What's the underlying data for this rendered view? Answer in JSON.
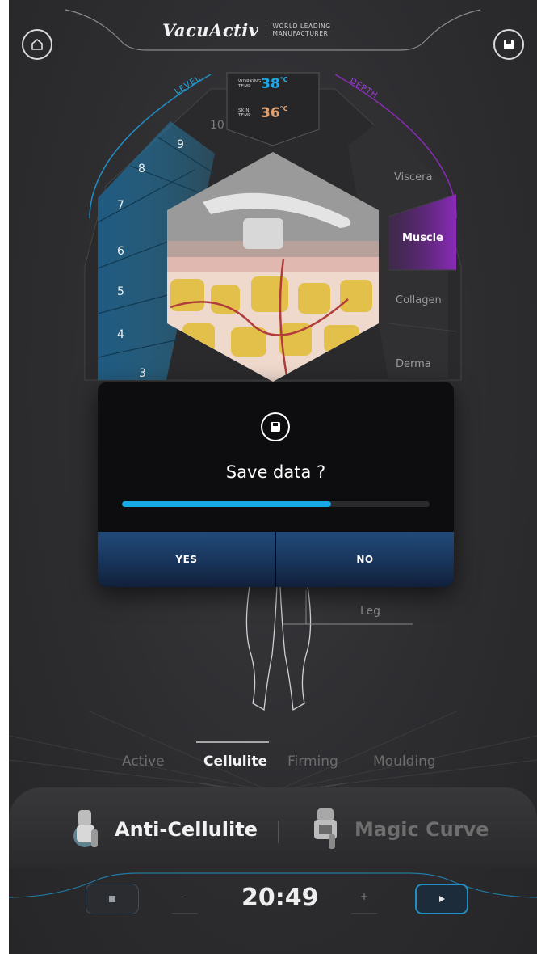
{
  "header": {
    "brand": "VacuActiv",
    "tagline_line1": "WORLD LEADING",
    "tagline_line2": "MANUFACTURER"
  },
  "icons": {
    "home": "home-icon",
    "save": "floppy-disk-icon"
  },
  "gauge": {
    "level_label": "LEVEL",
    "depth_label": "DEPTH",
    "working_temp_label_line1": "WORKING",
    "working_temp_label_line2": "TEMP",
    "working_temp_value": "38",
    "working_temp_unit": "°C",
    "skin_temp_label_line1": "SKIN",
    "skin_temp_label_line2": "TEMP",
    "skin_temp_value": "36",
    "skin_temp_unit": "°C",
    "levels": [
      "3",
      "4",
      "5",
      "6",
      "7",
      "8",
      "9",
      "10"
    ],
    "selected_level": 9,
    "depths": [
      "Viscera",
      "Muscle",
      "Collagen",
      "Derma"
    ],
    "selected_depth": "Muscle"
  },
  "colors": {
    "level_accent": "#1f8fc4",
    "depth_accent": "#8a2bb8",
    "working_temp": "#1fa8e6",
    "skin_temp": "#e0a070",
    "progress": "#17a9e3"
  },
  "dialog": {
    "title": "Save data ?",
    "progress_fraction": 0.68,
    "yes_label": "YES",
    "no_label": "NO"
  },
  "body_area": {
    "label": "Leg"
  },
  "modes": {
    "tabs": [
      "Active",
      "Cellulite",
      "Firming",
      "Moulding"
    ],
    "selected": "Cellulite"
  },
  "programs": {
    "items": [
      "Anti-Cellulite",
      "Magic Curve"
    ],
    "selected": "Anti-Cellulite"
  },
  "controls": {
    "minus_label": "-",
    "plus_label": "+",
    "timer": "20:49"
  }
}
